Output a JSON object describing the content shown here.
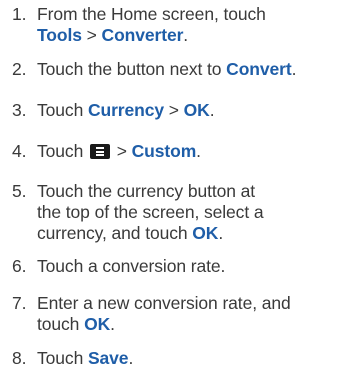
{
  "steps": [
    {
      "number": "1.",
      "line1_prefix": "From the Home screen, touch",
      "tools": "Tools",
      "sep": " > ",
      "converter": "Converter",
      "end": "."
    },
    {
      "number": "2.",
      "prefix": "Touch the button next to ",
      "convert": "Convert",
      "end": "."
    },
    {
      "number": "3.",
      "prefix": "Touch ",
      "currency": "Currency",
      "sep": " > ",
      "ok": "OK",
      "end": "."
    },
    {
      "number": "4.",
      "prefix": "Touch ",
      "icon": "menu-icon",
      "sep": " > ",
      "custom": "Custom",
      "end": "."
    },
    {
      "number": "5.",
      "line1": "Touch the currency button at",
      "line2": "the top of the screen, select a",
      "line3_prefix": "currency, and touch ",
      "ok": "OK",
      "end": "."
    },
    {
      "number": "6.",
      "text": "Touch a conversion rate."
    },
    {
      "number": "7.",
      "line1": "Enter a new conversion rate, and",
      "line2_prefix": "touch ",
      "ok": "OK",
      "end": "."
    },
    {
      "number": "8.",
      "prefix": "Touch ",
      "save": "Save",
      "end": "."
    }
  ],
  "colors": {
    "text": "#3a3a3a",
    "emphasis": "#1f5ea8",
    "icon_bg": "#1a1a1a"
  }
}
